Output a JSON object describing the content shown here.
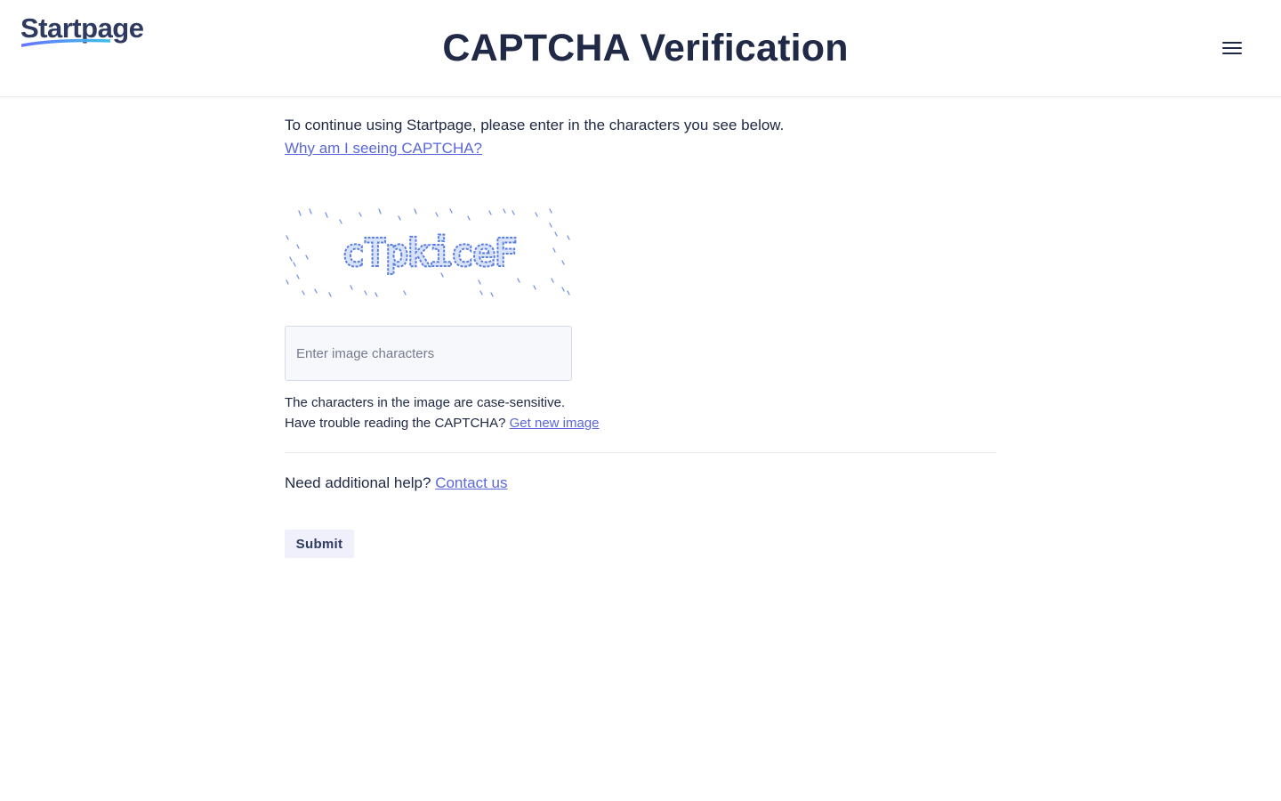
{
  "header": {
    "logo_text": "Startpage",
    "title": "CAPTCHA Verification",
    "menu_icon": "hamburger-menu-icon"
  },
  "main": {
    "intro_text": "To continue using Startpage, please enter in the characters you see below.",
    "why_link": "Why am I seeing CAPTCHA?",
    "captcha_text": "cTpkiceF",
    "input": {
      "placeholder": "Enter image characters",
      "value": ""
    },
    "case_sensitive_note": "The characters in the image are case-sensitive.",
    "trouble_text": "Have trouble reading the CAPTCHA?",
    "new_image_link": "Get new image",
    "help_text": "Need additional help?",
    "contact_link": "Contact us",
    "submit_label": "Submit"
  },
  "colors": {
    "text": "#202945",
    "link": "#6573ff",
    "captcha_blue": "#5b7fe0",
    "logo_gradient_start": "#6573ff",
    "logo_gradient_end": "#3fc0e8"
  }
}
